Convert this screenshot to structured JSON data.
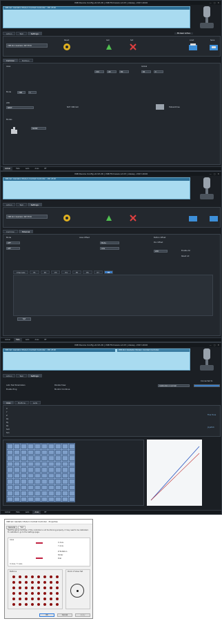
{
  "window1": {
    "title": "VKB Device Config v0.93.26 | VKB Firmware v2.03 | Alexey, 2017-2020",
    "banner": "VKB-Sim Gladiator Modern Combat Controller - VID 231D",
    "tabs": [
      "Action",
      "Test",
      "Settings"
    ],
    "active_tab": "Settings",
    "device": "VKB-Sim Gladiator NXT EVO",
    "status": "Bt-Gear Active",
    "icons": {
      "reset": "Reset",
      "get": "Get",
      "set": "Set",
      "load": "Load",
      "save": "Save",
      "joystick": "joystick-icon"
    },
    "sub_tabs": [
      "Common",
      "Buttons"
    ],
    "labels": {
      "axes": "Axes",
      "global": "Global",
      "bitmask": "Bitmask",
      "hatswitches": "Hatswitches",
      "mode": "Mode",
      "shift": "Shift",
      "pov": "POV",
      "pov_mode": "Mode",
      "modes": "Modes",
      "bt": "BT",
      "switch": "Switch",
      "set": "Set",
      "delay": "Delay",
      "led": "LED"
    },
    "fields": {
      "axes_a": "210",
      "axes_b": "A8",
      "axes_c": "B0",
      "global_a": "60",
      "global_b": "0",
      "main_a": "VKB",
      "main_b": "1",
      "led": "NEXT",
      "bitmask": "NXT VKB-Sim",
      "brake": "NONE"
    },
    "footer_tabs": [
      "Global",
      "Hats",
      "Leds",
      "Axes",
      "BT"
    ],
    "active_footer": "Global"
  },
  "window2": {
    "title": "VKB Device Config v0.93.26 | VKB Firmware v2.03 | Alexey, 2017-2020",
    "banner": "VKB-Sim Gladiator Modern Combat Controller - VID 231D",
    "tabs": [
      "Action",
      "Test",
      "Settings"
    ],
    "device": "VKB-Sim Gladiator NXT EVO",
    "sub_tabs": [
      "Common",
      "External"
    ],
    "labels": {
      "mode": "Mode",
      "shift": "Shift",
      "ext": "Ext",
      "led": "LED",
      "port": "Port",
      "virt": "Virt",
      "multi": "Multi",
      "axes_offset": "Axes Offset",
      "button_offset": "Button Offset",
      "pov_offset": "Pov Offset",
      "bypass": "Bypass",
      "enable_all": "Enable All",
      "reset_all": "Reset All"
    },
    "fields": {
      "shift_a": "OFF",
      "shift_b": "OFF",
      "led_a": "Mode",
      "led_b": "Axis",
      "enable_c": "LED"
    },
    "channels": [
      "Channels",
      "P1",
      "P2",
      "P3",
      "P4",
      "P5",
      "P6",
      "P7",
      "P8"
    ],
    "active_channel": "P8",
    "footer_tabs": [
      "Global",
      "Hats",
      "Leds",
      "Axes",
      "BT"
    ],
    "active_footer": "Hats",
    "set_button": "Set"
  },
  "window3": {
    "title": "VKB Device Config v0.93.26 | VKB Firmware v2.03 | Alexey, 2017-2020",
    "banner": "VKB-Sim Gladiator Modern Combat Controller - VID 231D",
    "banner_right": "VKB-Sim Gladiator Modern Combat Controller",
    "tabs": [
      "Action",
      "Test",
      "Settings"
    ],
    "check_a": "Auto Test Parameters",
    "check_b": "Parallel View",
    "check_c": "Enable Prog",
    "check_d": "Monitor Continue",
    "calibrate": "Calibration (normal)",
    "connected": "Connected to",
    "sub_tabs": [
      "Axes",
      "Buttons",
      "Leds"
    ],
    "axis_rows": [
      "X",
      "Y",
      "Z",
      "Rx",
      "Ry",
      "Rz",
      "SL0",
      "SL1"
    ],
    "side_labels": [
      "Fine Tune",
      "Joystick"
    ],
    "footer_tabs": [
      "Global",
      "Hats",
      "Leds",
      "Axes",
      "BT"
    ],
    "active_footer": "Axes"
  },
  "dialog": {
    "title": "VKB-Sim Gladiator Modern Combat Controller - Properties",
    "tabs": [
      "General",
      "Test"
    ],
    "note": "Test the game controller. If the controller is not functioning properly, it may need to be calibrated. To calibrate it, go to the Settings page.",
    "axes_label": "Axes",
    "axes_list": [
      "X Axis",
      "Y Axis",
      "Z Rotation",
      "Slider",
      "Dial"
    ],
    "axis_pov": "X Axis / Y Axis",
    "buttons_label": "Buttons",
    "pov_label": "Point of View Hat",
    "ok": "OK",
    "cancel": "Cancel",
    "apply": "Apply"
  },
  "colors": {
    "accent": "#a9dbf0",
    "panel": "#23282e",
    "dot": "#8b1010"
  }
}
